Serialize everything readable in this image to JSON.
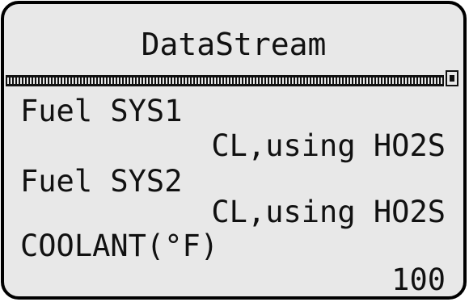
{
  "screen": {
    "title": "DataStream",
    "items": [
      {
        "label": "Fuel SYS1",
        "value": "CL,using HO2S"
      },
      {
        "label": "Fuel SYS2",
        "value": "CL,using HO2S"
      },
      {
        "label": "COOLANT(°F)",
        "value": "100"
      }
    ]
  },
  "colors": {
    "lcd_background": "#e8e8e8",
    "text": "#111111",
    "frame": "#000000"
  }
}
